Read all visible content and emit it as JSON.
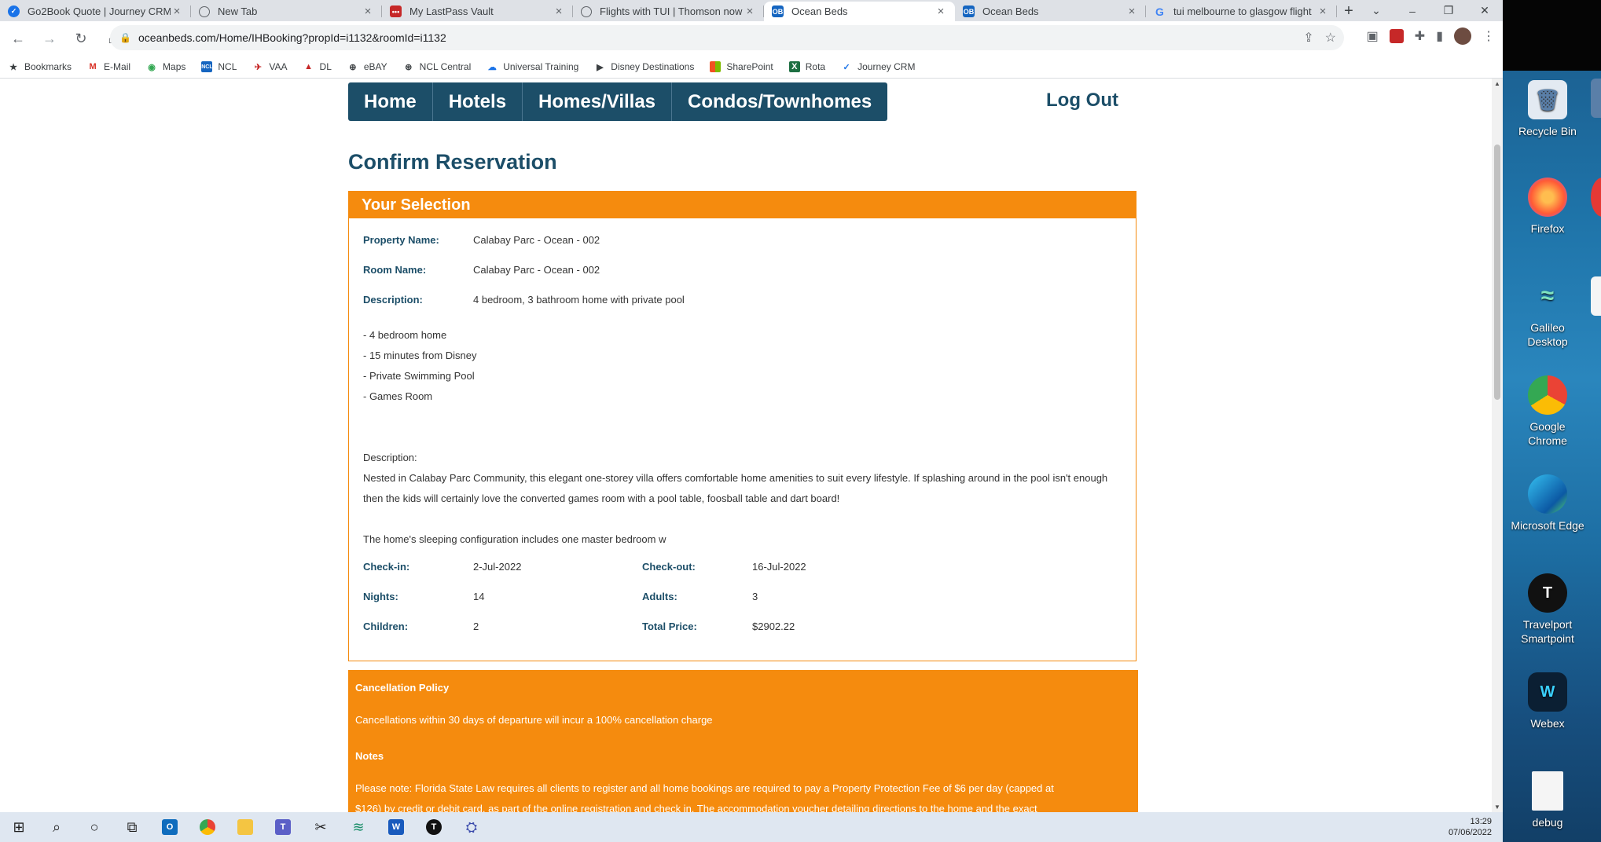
{
  "browser": {
    "tabs": [
      {
        "title": "Go2Book Quote | Journey CRM",
        "favicon_color": "#1a73e8",
        "active": false
      },
      {
        "title": "New Tab",
        "favicon_color": "#5f6368",
        "active": false
      },
      {
        "title": "My LastPass Vault",
        "favicon_color": "#c62828",
        "active": false
      },
      {
        "title": "Flights with TUI | Thomson now",
        "favicon_color": "#5f6368",
        "active": false
      },
      {
        "title": "Ocean Beds",
        "favicon_color": "#1565c0",
        "active": true
      },
      {
        "title": "Ocean Beds",
        "favicon_color": "#1565c0",
        "active": false
      },
      {
        "title": "tui melbourne to glasgow flight",
        "favicon_color": "#4285f4",
        "active": false
      }
    ],
    "url": "oceanbeds.com/Home/IHBooking?propId=i1132&roomId=i1132",
    "bookmarks": [
      {
        "label": "Bookmarks",
        "icon": "star-icon"
      },
      {
        "label": "E-Mail",
        "icon": "gmail-icon"
      },
      {
        "label": "Maps",
        "icon": "maps-icon"
      },
      {
        "label": "NCL",
        "icon": "ncl-icon"
      },
      {
        "label": "VAA",
        "icon": "vaa-icon"
      },
      {
        "label": "DL",
        "icon": "dl-icon"
      },
      {
        "label": "eBAY",
        "icon": "ebay-icon"
      },
      {
        "label": "NCL Central",
        "icon": "ncl-central-icon"
      },
      {
        "label": "Universal Training",
        "icon": "universal-icon"
      },
      {
        "label": "Disney Destinations",
        "icon": "disney-icon"
      },
      {
        "label": "SharePoint",
        "icon": "sharepoint-icon"
      },
      {
        "label": "Rota",
        "icon": "excel-icon"
      },
      {
        "label": "Journey CRM",
        "icon": "journey-crm-icon"
      }
    ]
  },
  "site": {
    "nav": [
      "Home",
      "Hotels",
      "Homes/Villas",
      "Condos/Townhomes"
    ],
    "logout": "Log Out",
    "page_title": "Confirm Reservation",
    "selection_header": "Your Selection",
    "property_name_label": "Property Name:",
    "property_name": "Calabay Parc - Ocean - 002",
    "room_name_label": "Room Name:",
    "room_name": "Calabay Parc - Ocean - 002",
    "description_label": "Description:",
    "description_short": "4 bedroom, 3 bathroom home with private pool",
    "features": [
      "- 4 bedroom home",
      "- 15 minutes from Disney",
      "- Private Swimming Pool",
      "- Games Room"
    ],
    "description_heading": "Description:",
    "description_long": "Nested in Calabay Parc Community, this elegant one-storey villa offers comfortable home amenities to suit every lifestyle. If splashing around in the pool isn't enough then the kids will certainly love the converted games room with a pool table, foosball table and dart board!",
    "description_more": "The home's sleeping configuration includes one master bedroom w",
    "checkin_label": "Check-in:",
    "checkin": "2-Jul-2022",
    "checkout_label": "Check-out:",
    "checkout": "16-Jul-2022",
    "nights_label": "Nights:",
    "nights": "14",
    "adults_label": "Adults:",
    "adults": "3",
    "children_label": "Children:",
    "children": "2",
    "total_label": "Total Price:",
    "total": "$2902.22",
    "cancellation_heading": "Cancellation Policy",
    "cancellation_text": "Cancellations within 30 days of departure will incur a 100% cancellation charge",
    "notes_heading": "Notes",
    "notes_text_1": "Please note: Florida State Law requires all clients to register and all home bookings are required to pay a Property Protection Fee of $6 per day (capped at",
    "notes_text_2": "$126) by credit or debit card, as part of the online registration and check in. The accommodation voucher detailing directions to the home and the exact"
  },
  "taskbar": {
    "time": "13:29",
    "date": "07/06/2022"
  },
  "desktop_icons": [
    "Recycle Bin",
    "Firefox",
    "Galileo Desktop",
    "Google Chrome",
    "Microsoft Edge",
    "Travelport Smartpoint",
    "Webex",
    "debug"
  ],
  "colors": {
    "nav_blue": "#1c4e68",
    "orange": "#f58b0e"
  }
}
